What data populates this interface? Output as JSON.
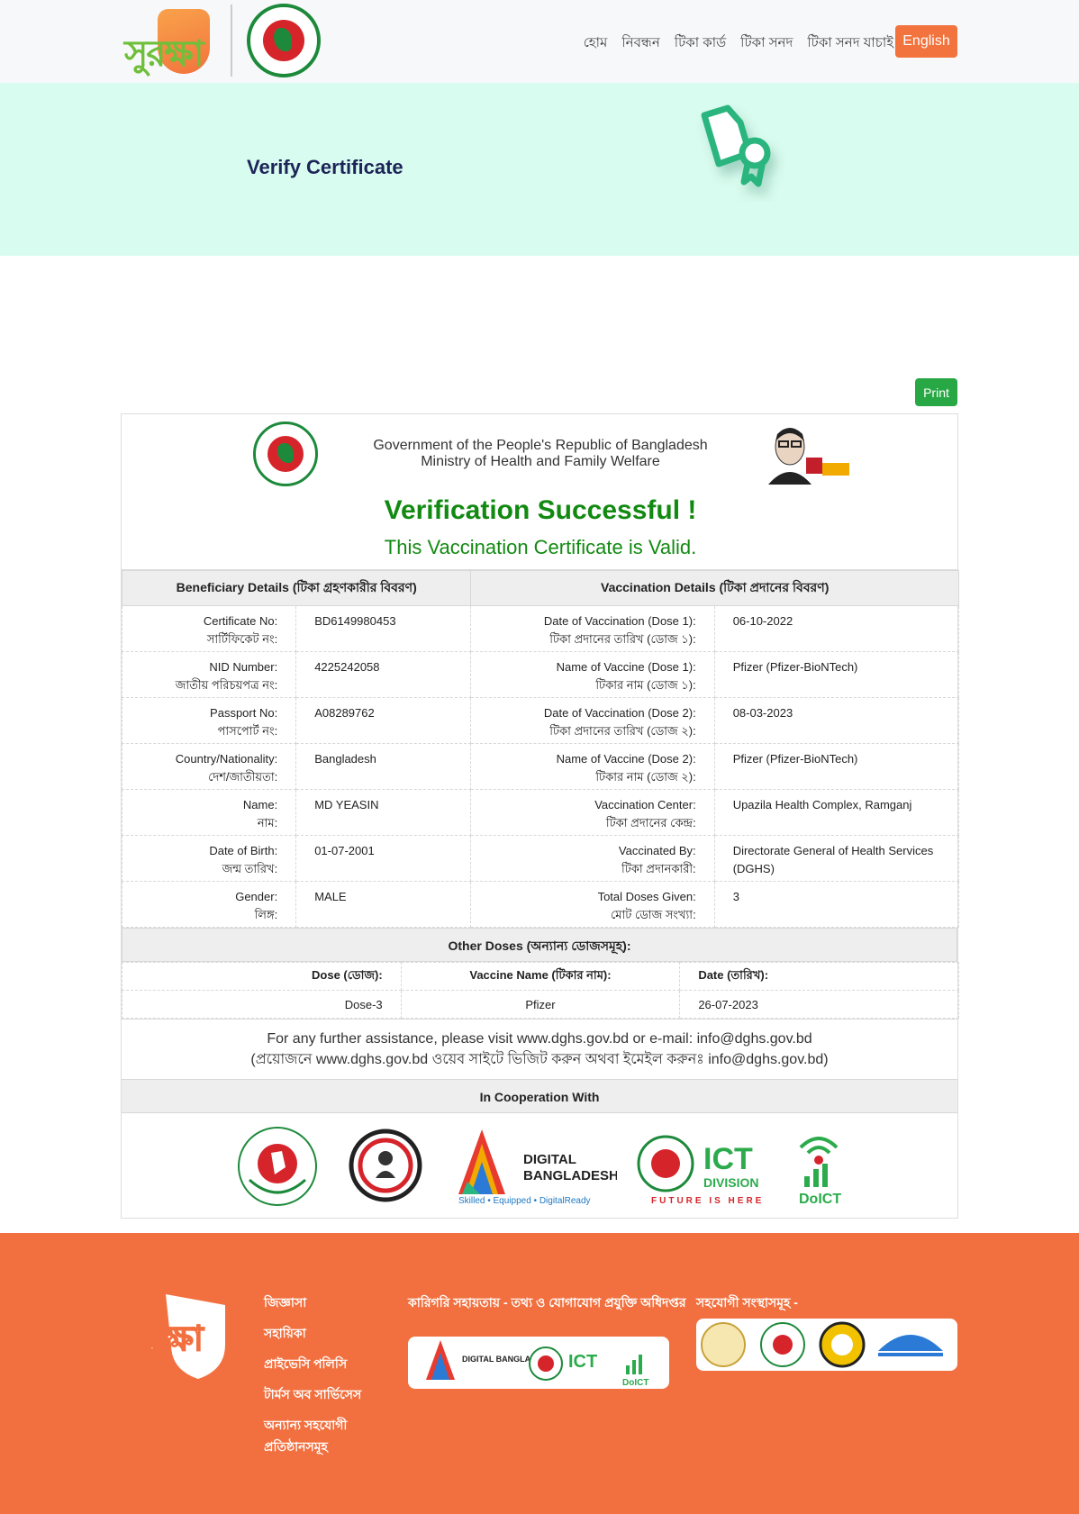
{
  "header": {
    "brand_text": "সুরক্ষা",
    "nav": [
      "হোম",
      "নিবন্ধন",
      "টিকা কার্ড",
      "টিকা সনদ",
      "টিকা সনদ যাচাই"
    ],
    "lang_button": "English"
  },
  "hero": {
    "title": "Verify Certificate"
  },
  "print_label": "Print",
  "certificate": {
    "gov_line1": "Government of the People's Republic of Bangladesh",
    "gov_line2": "Ministry of Health and Family Welfare",
    "verified_title": "Verification Successful !",
    "valid_text": "This Vaccination Certificate is Valid.",
    "beneficiary_header": "Beneficiary Details (টিকা গ্রহণকারীর বিবরণ)",
    "vaccination_header": "Vaccination Details (টিকা প্রদানের বিবরণ)",
    "rows": [
      {
        "l1": "Certificate No:",
        "l1b": "সার্টিফিকেট নং:",
        "v1": "BD6149980453",
        "l2": "Date of Vaccination (Dose 1):",
        "l2b": "টিকা প্রদানের তারিখ (ডোজ ১):",
        "v2": "06-10-2022"
      },
      {
        "l1": "NID Number:",
        "l1b": "জাতীয় পরিচয়পত্র নং:",
        "v1": "4225242058",
        "l2": "Name of Vaccine (Dose 1):",
        "l2b": "টিকার নাম (ডোজ ১):",
        "v2": "Pfizer (Pfizer-BioNTech)"
      },
      {
        "l1": "Passport No:",
        "l1b": "পাসপোর্ট নং:",
        "v1": "A08289762",
        "l2": "Date of Vaccination (Dose 2):",
        "l2b": "টিকা প্রদানের তারিখ (ডোজ ২):",
        "v2": "08-03-2023"
      },
      {
        "l1": "Country/Nationality:",
        "l1b": "দেশ/জাতীয়তা:",
        "v1": "Bangladesh",
        "l2": "Name of Vaccine (Dose 2):",
        "l2b": "টিকার নাম (ডোজ ২):",
        "v2": "Pfizer (Pfizer-BioNTech)"
      },
      {
        "l1": "Name:",
        "l1b": "নাম:",
        "v1": "MD YEASIN",
        "l2": "Vaccination Center:",
        "l2b": "টিকা প্রদানের কেন্দ্র:",
        "v2": "Upazila Health Complex, Ramganj"
      },
      {
        "l1": "Date of Birth:",
        "l1b": "জন্ম তারিখ:",
        "v1": "01-07-2001",
        "l2": "Vaccinated By:",
        "l2b": "টিকা প্রদানকারী:",
        "v2": "Directorate General of Health Services (DGHS)"
      },
      {
        "l1": "Gender:",
        "l1b": "লিঙ্গ:",
        "v1": "MALE",
        "l2": "Total Doses Given:",
        "l2b": "মোট ডোজ সংখ্যা:",
        "v2": "3"
      }
    ],
    "other_doses_title": "Other Doses (অন্যান্য ডোজসমূহ):",
    "dose_headers": [
      "Dose (ডোজ):",
      "Vaccine Name (টিকার নাম):",
      "Date (তারিখ):"
    ],
    "doses": [
      {
        "dose": "Dose-3",
        "vaccine": "Pfizer",
        "date": "26-07-2023"
      }
    ],
    "assist_en": "For any further assistance, please visit www.dghs.gov.bd or e-mail: info@dghs.gov.bd",
    "assist_bn": "(প্রয়োজনে www.dghs.gov.bd ওয়েব সাইটে ভিজিট করুন অথবা ইমেইল করুনঃ info@dghs.gov.bd)",
    "coop_title": "In Cooperation With",
    "coop_logos": {
      "digital_bd": "DIGITAL BANGLADESH",
      "digital_bd_tag": "Skilled • Equipped • DigitalReady",
      "ict": "ICT",
      "ict_division": "DIVISION",
      "ict_tag": "FUTURE IS HERE",
      "doict": "DoICT"
    }
  },
  "footer": {
    "links": [
      "জিজ্ঞাসা",
      "সহায়িকা",
      "প্রাইভেসি পলিসি",
      "টার্মস অব সার্ভিসেস",
      "অন্যান্য সহযোগী প্রতিষ্ঠানসমূহ"
    ],
    "tech_support": "কারিগরি সহায়তায় - তথ্য ও যোগাযোগ প্রযুক্তি অধিদপ্তর",
    "partners": "সহযোগী সংস্থাসমূহ -"
  },
  "colors": {
    "accent": "#f2733d",
    "success": "#128a12",
    "hero_bg": "#d9fcf0",
    "footer_bg": "#f2703f"
  }
}
